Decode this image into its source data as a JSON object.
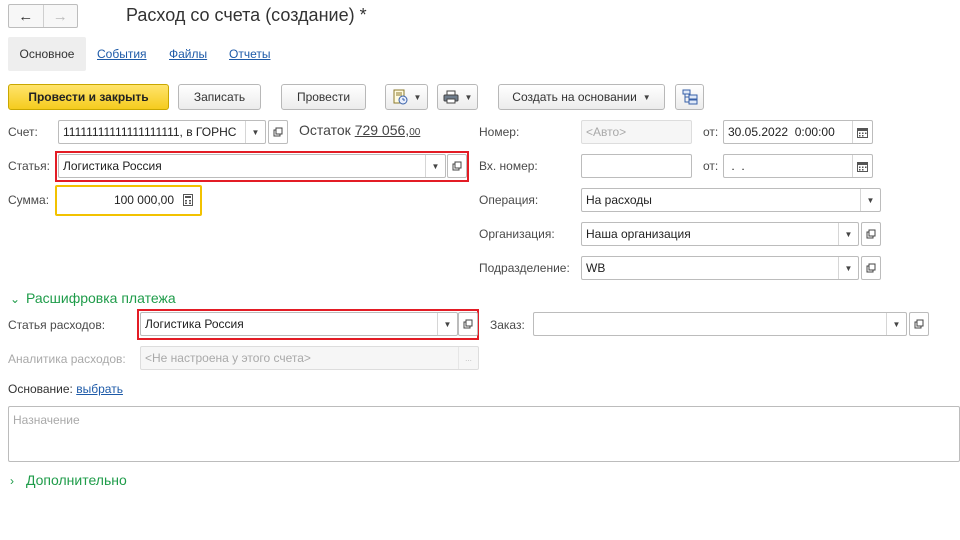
{
  "window": {
    "title": "Расход со счета (создание) *"
  },
  "nav": {
    "back_icon": "arrow-left-icon",
    "forward_icon": "arrow-right-icon"
  },
  "tabs": [
    {
      "label": "Основное"
    },
    {
      "label": "События"
    },
    {
      "label": "Файлы"
    },
    {
      "label": "Отчеты"
    }
  ],
  "toolbar": {
    "post_close": "Провести и закрыть",
    "save": "Записать",
    "post": "Провести",
    "create_based": "Создать на основании"
  },
  "left": {
    "account_label": "Счет:",
    "account_value": "11111111111111111111, в ГОРНС",
    "balance_label": "Остаток",
    "balance_value": "729 056,",
    "balance_cents": "00",
    "article_label": "Статья:",
    "article_value": "Логистика Россия",
    "sum_label": "Сумма:",
    "sum_value": "100 000,00"
  },
  "right": {
    "number_label": "Номер:",
    "number_placeholder": "<Авто>",
    "from_label": "от:",
    "date_value": "30.05.2022  0:00:00",
    "in_number_label": "Вх. номер:",
    "in_from_label": "от:",
    "in_date_value": " .  .",
    "operation_label": "Операция:",
    "operation_value": "На расходы",
    "org_label": "Организация:",
    "org_value": "Наша организация",
    "dept_label": "Подразделение:",
    "dept_value": "WB"
  },
  "decoding": {
    "title": "Расшифровка платежа",
    "expense_article_label": "Статья расходов:",
    "expense_article_value": "Логистика Россия",
    "order_label": "Заказ:",
    "order_value": "",
    "analytics_label": "Аналитика расходов:",
    "analytics_placeholder": "<Не настроена у этого счета>"
  },
  "basis": {
    "label": "Основание:",
    "link": "выбрать"
  },
  "purpose": {
    "placeholder": "Назначение"
  },
  "additional": {
    "title": "Дополнительно"
  },
  "colors": {
    "accent_yellow": "#f5cc1e",
    "section_green": "#1f9c4a",
    "link_blue": "#1d5aa8",
    "highlight_red": "#e31c25"
  }
}
